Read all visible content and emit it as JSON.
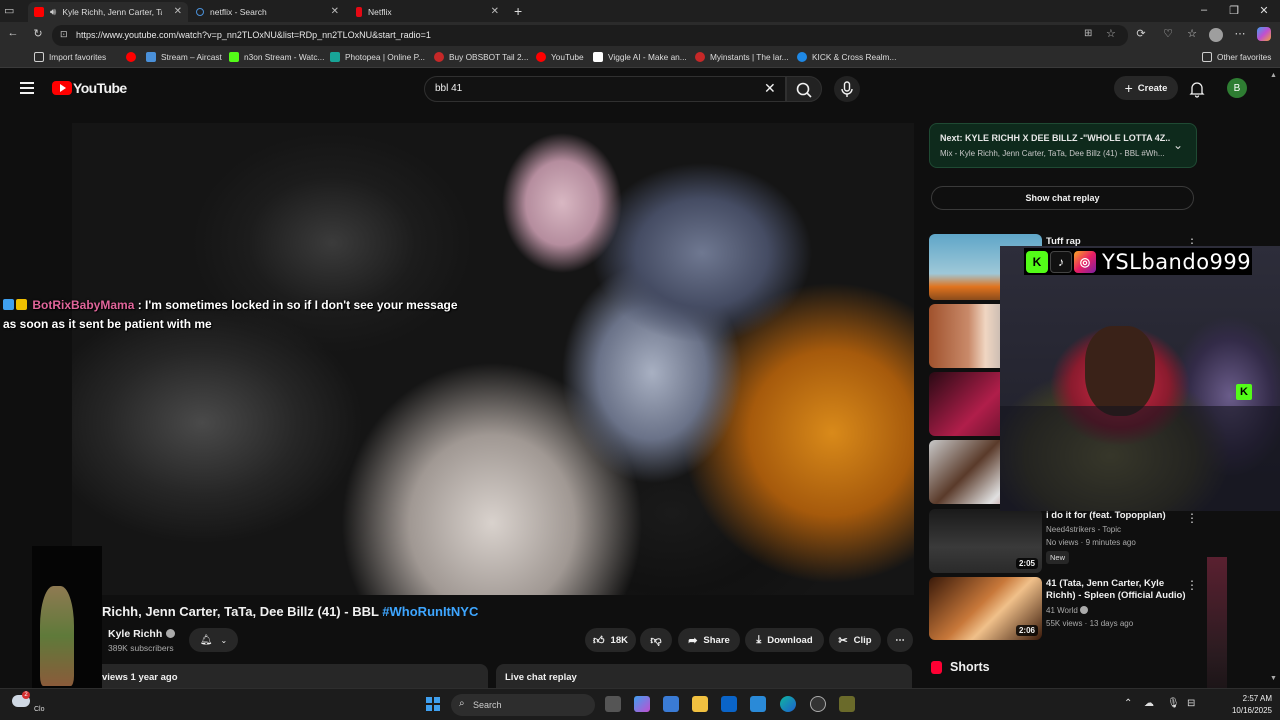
{
  "browser": {
    "tabs": [
      {
        "label": "Kyle Richh, Jenn Carter, TaTa",
        "active": true,
        "favicon": "youtube-icon",
        "color": "#ff0000"
      },
      {
        "label": "netflix - Search",
        "active": false,
        "favicon": "search-icon",
        "color": "#4a90d9"
      },
      {
        "label": "Netflix",
        "active": false,
        "favicon": "netflix-icon",
        "color": "#e50914"
      }
    ],
    "url": "https://www.youtube.com/watch?v=p_nn2TLOxNU&list=RDp_nn2TLOxNU&start_radio=1",
    "bookmarks": [
      {
        "label": "Import favorites",
        "icon": "import-icon",
        "color": "#cfcfcf"
      },
      {
        "label": "",
        "icon": "youtube-icon",
        "color": "#ff0000"
      },
      {
        "label": "Stream – Aircast",
        "icon": "aircast-icon",
        "color": "#4a90d9"
      },
      {
        "label": "n3on Stream - Watc...",
        "icon": "kick-icon",
        "color": "#53fc18"
      },
      {
        "label": "Photopea | Online P...",
        "icon": "photopea-icon",
        "color": "#18a497"
      },
      {
        "label": "Buy OBSBOT Tail 2...",
        "icon": "obsbot-icon",
        "color": "#c62828"
      },
      {
        "label": "YouTube",
        "icon": "youtube-icon",
        "color": "#ff0000"
      },
      {
        "label": "Viggle AI - Make an...",
        "icon": "viggle-icon",
        "color": "#ffffff"
      },
      {
        "label": "Myinstants | The lar...",
        "icon": "myinstants-icon",
        "color": "#c62828"
      },
      {
        "label": "KICK & Cross Realm...",
        "icon": "kick-icon",
        "color": "#1e88e5"
      },
      {
        "label": "Other favorites",
        "icon": "folder-icon",
        "color": "#cfcfcf"
      }
    ]
  },
  "youtube": {
    "logo_text": "YouTube",
    "search_value": "bbl 41",
    "create_label": "Create",
    "avatar_letter": "B",
    "chat_overlay": {
      "user": "BotRixBabyMama",
      "message": ": I'm sometimes locked in so if I don't see your message as soon as it sent be patient with me"
    },
    "video": {
      "title_main": "Richh, Jenn Carter, TaTa, Dee Billz (41) - BBL ",
      "title_tag": "#WhoRunItNYC",
      "channel": "Kyle Richh",
      "subscribers": "389K subscribers",
      "likes": "18K",
      "share_label": "Share",
      "download_label": "Download",
      "clip_label": "Clip",
      "views": "views  1 year ago",
      "live_chat_replay": "Live chat replay"
    },
    "up_next": {
      "title": "Next: KYLE RICHH X DEE BILLZ -\"WHOLE LOTTA 4Z...",
      "subtitle": "Mix - Kyle Richh, Jenn Carter, TaTa, Dee Billz (41) - BBL #Wh..."
    },
    "show_chat_replay": "Show chat replay",
    "recommendations": [
      {
        "title": "Tuff rap",
        "meta1": "",
        "meta2": "",
        "duration": ""
      },
      {
        "title": "i do it for (feat. Topopplan)",
        "meta1": "Need4strikers - Topic",
        "meta2": "No views · 9 minutes ago",
        "badge": "New",
        "duration": "2:05"
      },
      {
        "title": "41 (Tata, Jenn Carter, Kyle Richh) - Spleen (Official Audio)",
        "meta1": "41 World",
        "meta2": "55K views · 13 days ago",
        "duration": "2:06"
      }
    ],
    "shorts_label": "Shorts"
  },
  "stream_overlay": {
    "handle": "YSLbando999",
    "social_icons": [
      "kick-icon",
      "tiktok-icon",
      "instagram-icon"
    ]
  },
  "left_overlay": {
    "caption": "Clo"
  },
  "taskbar": {
    "search_placeholder": "Search",
    "weather_badge": "2",
    "time": "2:57 AM",
    "date": "10/16/2025"
  }
}
